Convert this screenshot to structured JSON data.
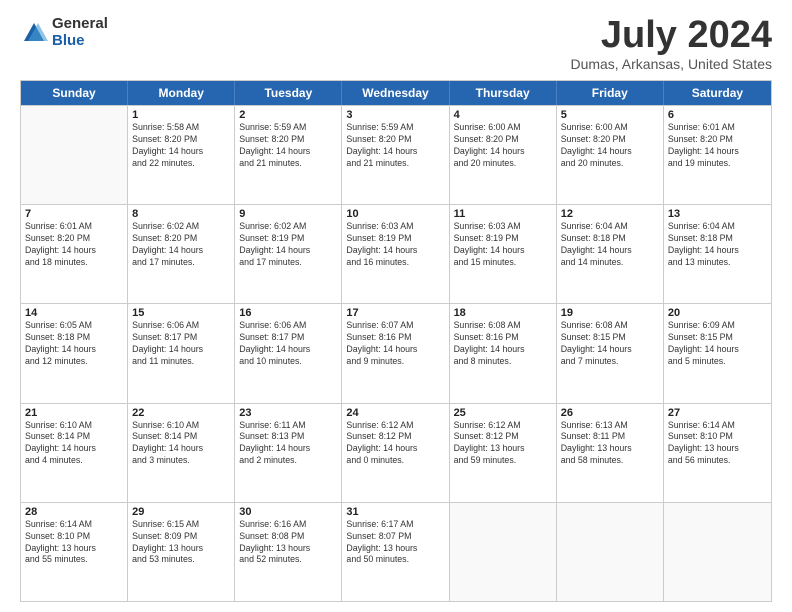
{
  "logo": {
    "general": "General",
    "blue": "Blue"
  },
  "title": "July 2024",
  "location": "Dumas, Arkansas, United States",
  "days": [
    "Sunday",
    "Monday",
    "Tuesday",
    "Wednesday",
    "Thursday",
    "Friday",
    "Saturday"
  ],
  "rows": [
    [
      {
        "day": "",
        "info": "",
        "empty": true
      },
      {
        "day": "1",
        "info": "Sunrise: 5:58 AM\nSunset: 8:20 PM\nDaylight: 14 hours\nand 22 minutes."
      },
      {
        "day": "2",
        "info": "Sunrise: 5:59 AM\nSunset: 8:20 PM\nDaylight: 14 hours\nand 21 minutes."
      },
      {
        "day": "3",
        "info": "Sunrise: 5:59 AM\nSunset: 8:20 PM\nDaylight: 14 hours\nand 21 minutes."
      },
      {
        "day": "4",
        "info": "Sunrise: 6:00 AM\nSunset: 8:20 PM\nDaylight: 14 hours\nand 20 minutes."
      },
      {
        "day": "5",
        "info": "Sunrise: 6:00 AM\nSunset: 8:20 PM\nDaylight: 14 hours\nand 20 minutes."
      },
      {
        "day": "6",
        "info": "Sunrise: 6:01 AM\nSunset: 8:20 PM\nDaylight: 14 hours\nand 19 minutes."
      }
    ],
    [
      {
        "day": "7",
        "info": "Sunrise: 6:01 AM\nSunset: 8:20 PM\nDaylight: 14 hours\nand 18 minutes."
      },
      {
        "day": "8",
        "info": "Sunrise: 6:02 AM\nSunset: 8:20 PM\nDaylight: 14 hours\nand 17 minutes."
      },
      {
        "day": "9",
        "info": "Sunrise: 6:02 AM\nSunset: 8:19 PM\nDaylight: 14 hours\nand 17 minutes."
      },
      {
        "day": "10",
        "info": "Sunrise: 6:03 AM\nSunset: 8:19 PM\nDaylight: 14 hours\nand 16 minutes."
      },
      {
        "day": "11",
        "info": "Sunrise: 6:03 AM\nSunset: 8:19 PM\nDaylight: 14 hours\nand 15 minutes."
      },
      {
        "day": "12",
        "info": "Sunrise: 6:04 AM\nSunset: 8:18 PM\nDaylight: 14 hours\nand 14 minutes."
      },
      {
        "day": "13",
        "info": "Sunrise: 6:04 AM\nSunset: 8:18 PM\nDaylight: 14 hours\nand 13 minutes."
      }
    ],
    [
      {
        "day": "14",
        "info": "Sunrise: 6:05 AM\nSunset: 8:18 PM\nDaylight: 14 hours\nand 12 minutes."
      },
      {
        "day": "15",
        "info": "Sunrise: 6:06 AM\nSunset: 8:17 PM\nDaylight: 14 hours\nand 11 minutes."
      },
      {
        "day": "16",
        "info": "Sunrise: 6:06 AM\nSunset: 8:17 PM\nDaylight: 14 hours\nand 10 minutes."
      },
      {
        "day": "17",
        "info": "Sunrise: 6:07 AM\nSunset: 8:16 PM\nDaylight: 14 hours\nand 9 minutes."
      },
      {
        "day": "18",
        "info": "Sunrise: 6:08 AM\nSunset: 8:16 PM\nDaylight: 14 hours\nand 8 minutes."
      },
      {
        "day": "19",
        "info": "Sunrise: 6:08 AM\nSunset: 8:15 PM\nDaylight: 14 hours\nand 7 minutes."
      },
      {
        "day": "20",
        "info": "Sunrise: 6:09 AM\nSunset: 8:15 PM\nDaylight: 14 hours\nand 5 minutes."
      }
    ],
    [
      {
        "day": "21",
        "info": "Sunrise: 6:10 AM\nSunset: 8:14 PM\nDaylight: 14 hours\nand 4 minutes."
      },
      {
        "day": "22",
        "info": "Sunrise: 6:10 AM\nSunset: 8:14 PM\nDaylight: 14 hours\nand 3 minutes."
      },
      {
        "day": "23",
        "info": "Sunrise: 6:11 AM\nSunset: 8:13 PM\nDaylight: 14 hours\nand 2 minutes."
      },
      {
        "day": "24",
        "info": "Sunrise: 6:12 AM\nSunset: 8:12 PM\nDaylight: 14 hours\nand 0 minutes."
      },
      {
        "day": "25",
        "info": "Sunrise: 6:12 AM\nSunset: 8:12 PM\nDaylight: 13 hours\nand 59 minutes."
      },
      {
        "day": "26",
        "info": "Sunrise: 6:13 AM\nSunset: 8:11 PM\nDaylight: 13 hours\nand 58 minutes."
      },
      {
        "day": "27",
        "info": "Sunrise: 6:14 AM\nSunset: 8:10 PM\nDaylight: 13 hours\nand 56 minutes."
      }
    ],
    [
      {
        "day": "28",
        "info": "Sunrise: 6:14 AM\nSunset: 8:10 PM\nDaylight: 13 hours\nand 55 minutes."
      },
      {
        "day": "29",
        "info": "Sunrise: 6:15 AM\nSunset: 8:09 PM\nDaylight: 13 hours\nand 53 minutes."
      },
      {
        "day": "30",
        "info": "Sunrise: 6:16 AM\nSunset: 8:08 PM\nDaylight: 13 hours\nand 52 minutes."
      },
      {
        "day": "31",
        "info": "Sunrise: 6:17 AM\nSunset: 8:07 PM\nDaylight: 13 hours\nand 50 minutes."
      },
      {
        "day": "",
        "info": "",
        "empty": true
      },
      {
        "day": "",
        "info": "",
        "empty": true
      },
      {
        "day": "",
        "info": "",
        "empty": true
      }
    ]
  ]
}
